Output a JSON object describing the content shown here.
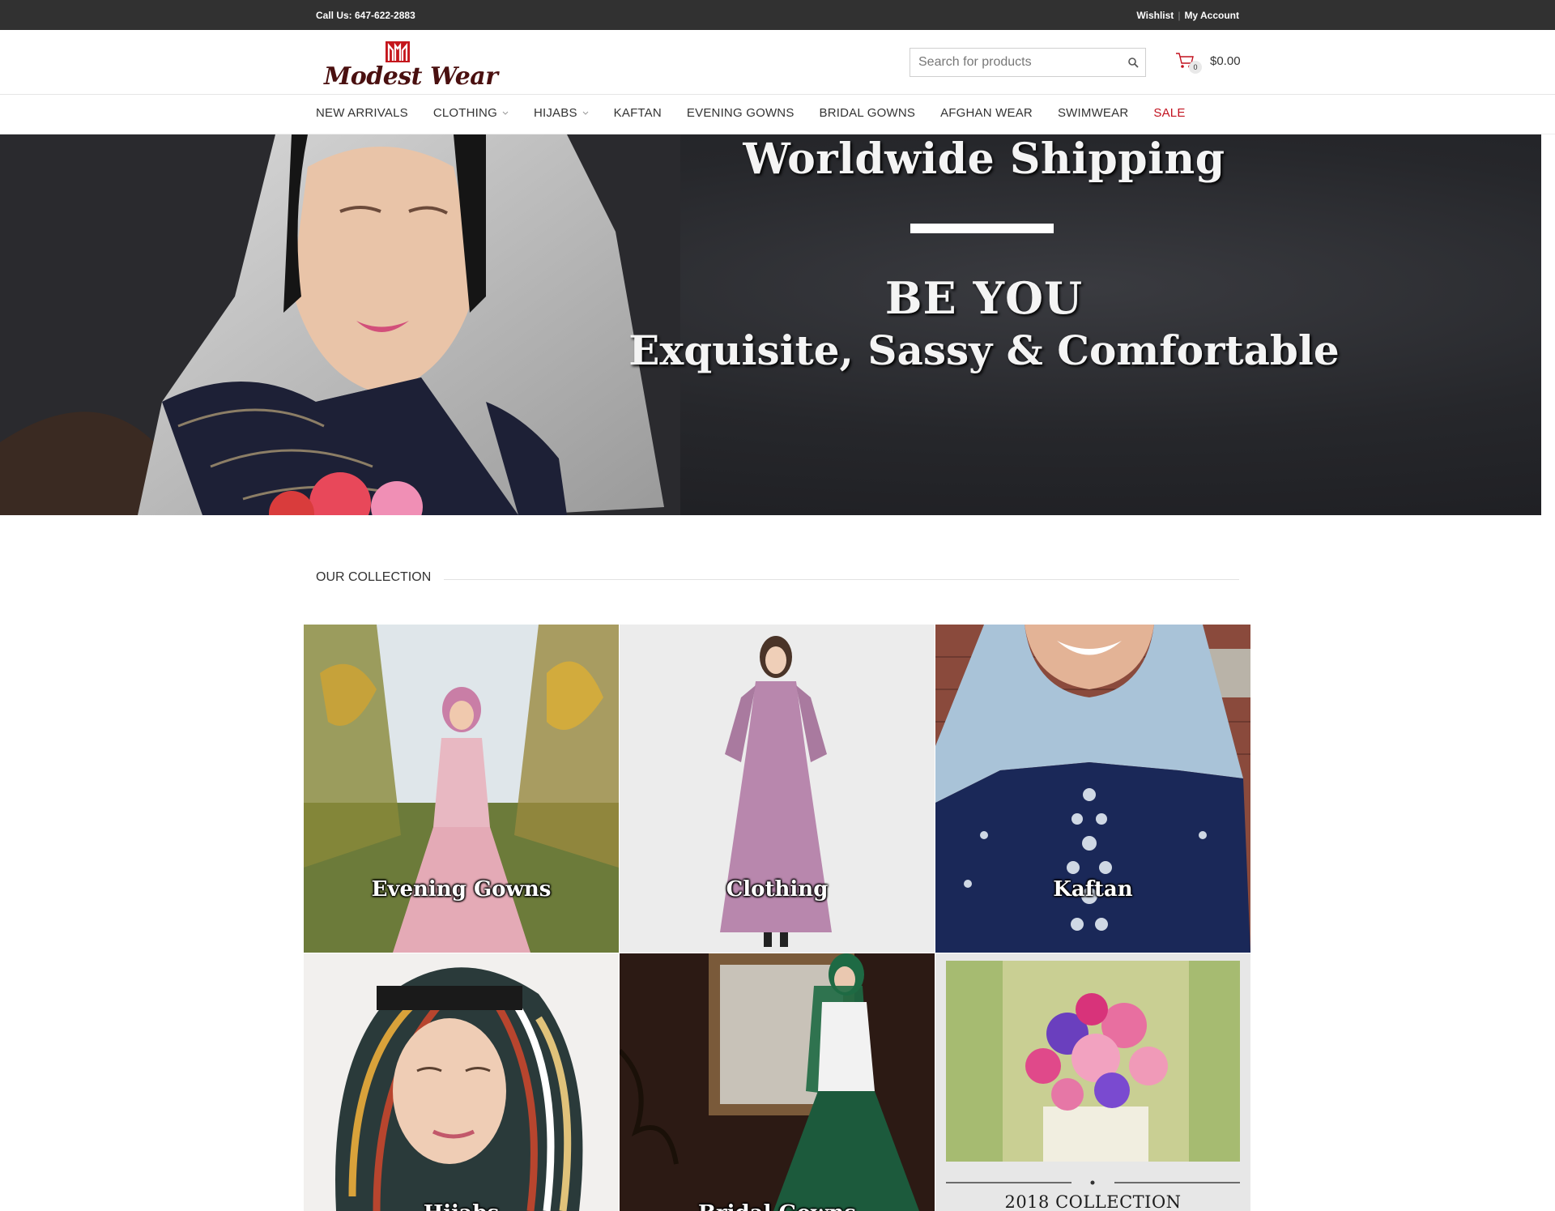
{
  "topbar": {
    "call": "Call Us: 647-622-2883",
    "wishlist": "Wishlist",
    "my_account": "My Account",
    "separator": "|"
  },
  "header": {
    "logo_text": "Modest Wear",
    "search_placeholder": "Search for products",
    "cart_count": "0",
    "cart_total": "$0.00"
  },
  "nav": {
    "items": [
      {
        "label": "NEW ARRIVALS"
      },
      {
        "label": "CLOTHING"
      },
      {
        "label": "HIJABS"
      },
      {
        "label": "KAFTAN"
      },
      {
        "label": "EVENING GOWNS"
      },
      {
        "label": "BRIDAL GOWNS"
      },
      {
        "label": "AFGHAN WEAR"
      },
      {
        "label": "SWIMWEAR"
      },
      {
        "label": "SALE"
      }
    ]
  },
  "hero": {
    "title": "Worldwide Shipping",
    "line1": "BE YOU",
    "line2": "Exquisite, Sassy & Comfortable"
  },
  "collection": {
    "heading": "OUR COLLECTION",
    "tiles": [
      {
        "caption": "Evening Gowns"
      },
      {
        "caption": "Clothing"
      },
      {
        "caption": "Kaftan"
      },
      {
        "caption": "Hijabs"
      },
      {
        "caption": "Bridal Gowns"
      },
      {
        "caption": "2018 COLLECTION"
      }
    ]
  },
  "colors": {
    "topbar_bg": "#313131",
    "sale": "#c2121f",
    "logo": "#4a1010",
    "logo_mark": "#c4161c"
  }
}
